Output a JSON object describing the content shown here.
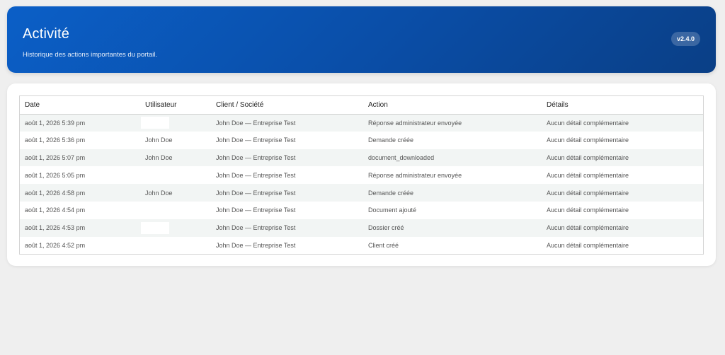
{
  "header": {
    "title": "Activité",
    "subtitle": "Historique des actions importantes du portail.",
    "version": "v2.4.0"
  },
  "table": {
    "columns": [
      "Date",
      "Utilisateur",
      "Client / Société",
      "Action",
      "Détails"
    ],
    "rows": [
      {
        "date": "août 1, 2026 5:39 pm",
        "user": "",
        "client": "John Doe — Entreprise Test",
        "action": "Réponse administrateur envoyée",
        "details": "Aucun détail complémentaire"
      },
      {
        "date": "août 1, 2026 5:36 pm",
        "user": "John Doe",
        "client": "John Doe — Entreprise Test",
        "action": "Demande créée",
        "details": "Aucun détail complémentaire"
      },
      {
        "date": "août 1, 2026 5:07 pm",
        "user": "John Doe",
        "client": "John Doe — Entreprise Test",
        "action": "document_downloaded",
        "details": "Aucun détail complémentaire"
      },
      {
        "date": "août 1, 2026 5:05 pm",
        "user": "",
        "client": "John Doe — Entreprise Test",
        "action": "Réponse administrateur envoyée",
        "details": "Aucun détail complémentaire"
      },
      {
        "date": "août 1, 2026 4:58 pm",
        "user": "John Doe",
        "client": "John Doe — Entreprise Test",
        "action": "Demande créée",
        "details": "Aucun détail complémentaire"
      },
      {
        "date": "août 1, 2026 4:54 pm",
        "user": "",
        "client": "John Doe — Entreprise Test",
        "action": "Document ajouté",
        "details": "Aucun détail complémentaire"
      },
      {
        "date": "août 1, 2026 4:53 pm",
        "user": "",
        "client": "John Doe — Entreprise Test",
        "action": "Dossier créé",
        "details": "Aucun détail complémentaire"
      },
      {
        "date": "août 1, 2026 4:52 pm",
        "user": "",
        "client": "John Doe — Entreprise Test",
        "action": "Client créé",
        "details": "Aucun détail complémentaire"
      }
    ]
  }
}
